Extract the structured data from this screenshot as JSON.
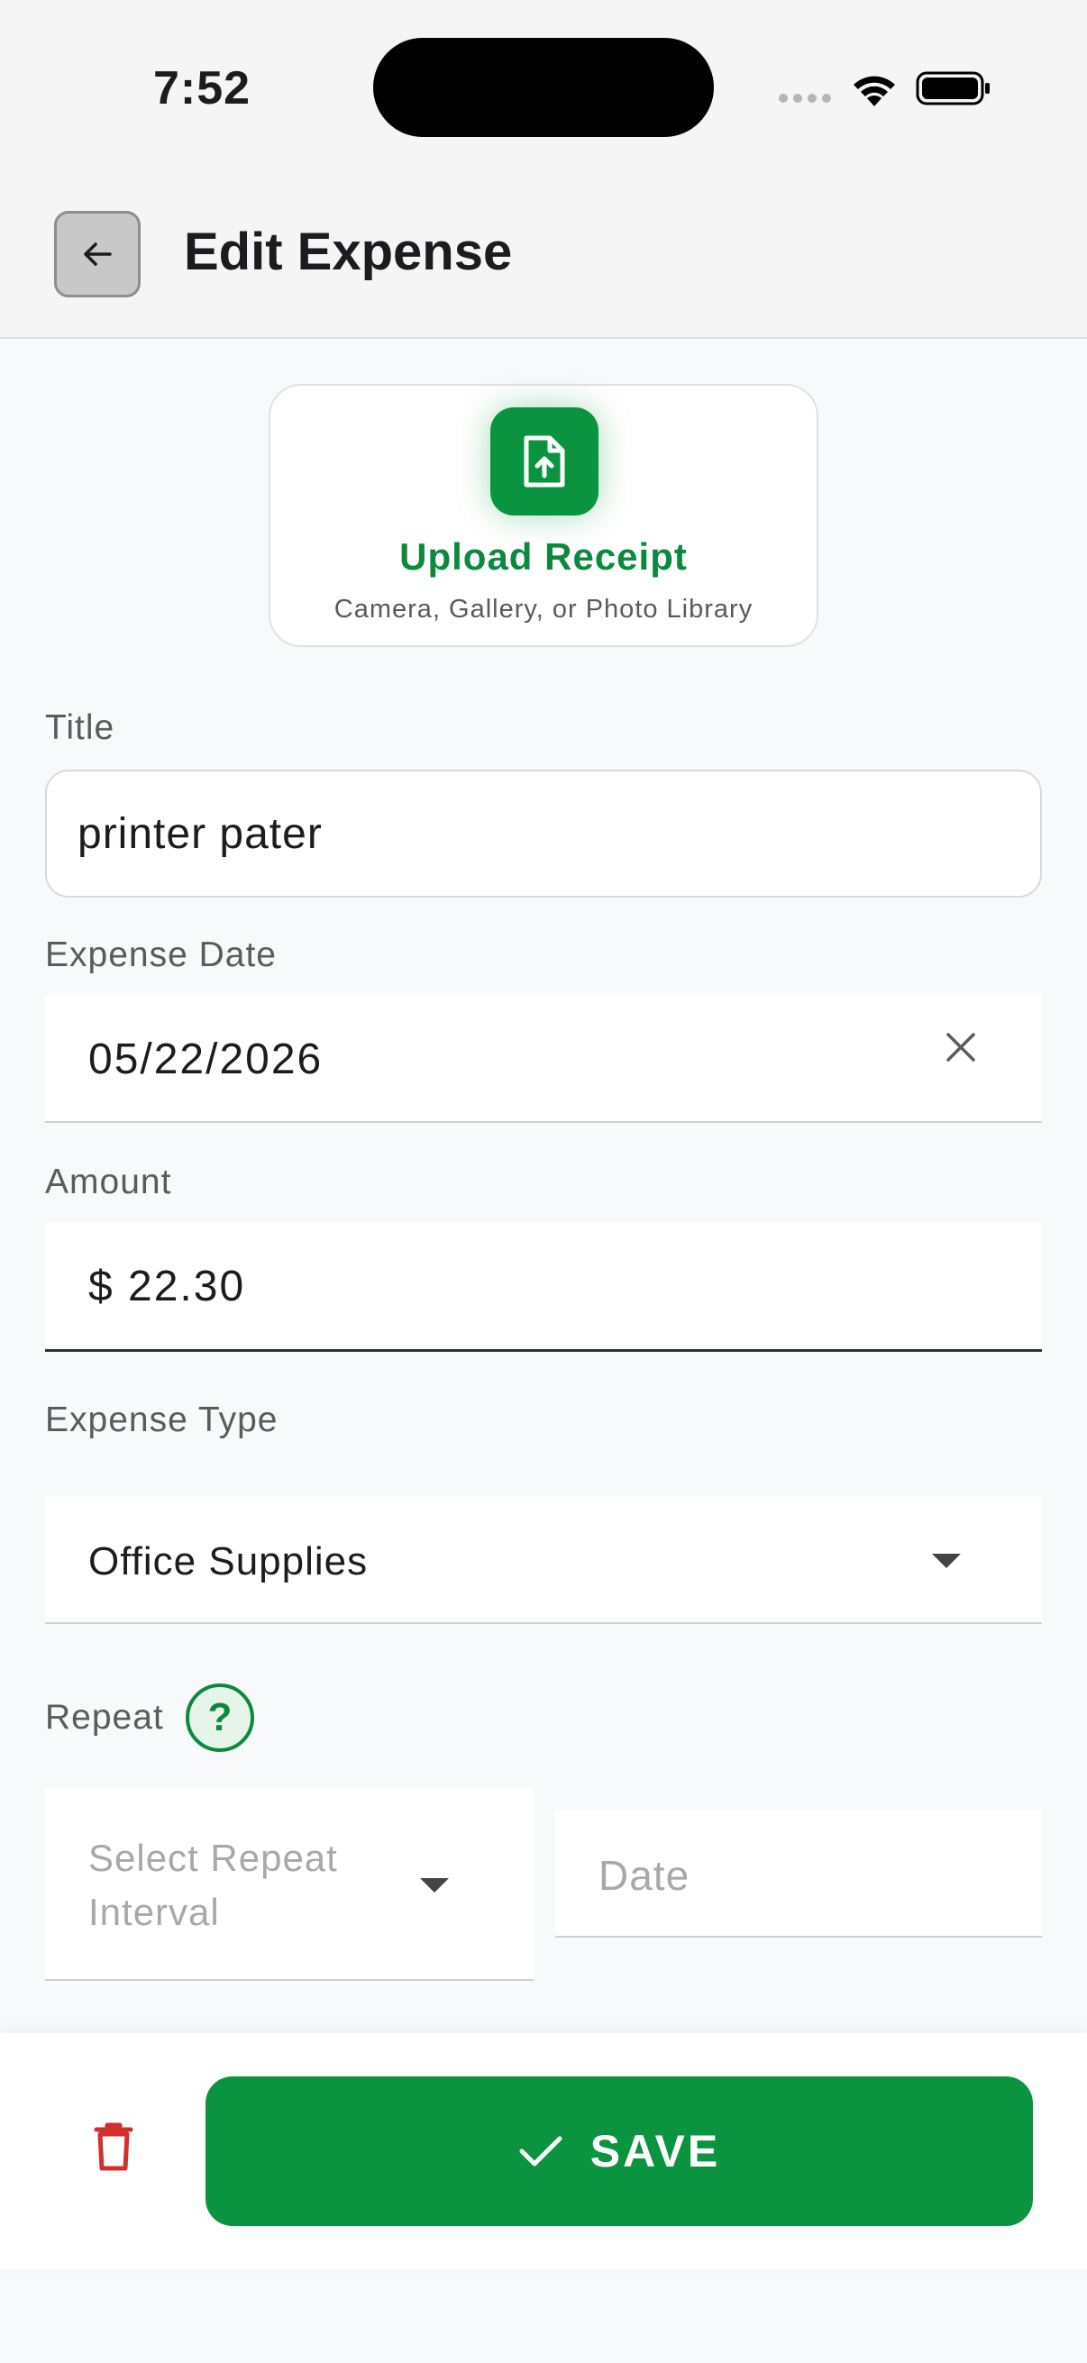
{
  "status": {
    "time": "7:52"
  },
  "header": {
    "title": "Edit Expense"
  },
  "upload": {
    "title": "Upload Receipt",
    "subtitle": "Camera, Gallery, or Photo Library"
  },
  "form": {
    "title_label": "Title",
    "title_value": "printer pater",
    "date_label": "Expense Date",
    "date_value": "05/22/2026",
    "amount_label": "Amount",
    "amount_value": "$ 22.30",
    "type_label": "Expense Type",
    "type_value": "Office Supplies",
    "repeat_label": "Repeat",
    "repeat_help": "?",
    "repeat_interval_placeholder": "Select Repeat Interval",
    "repeat_date_placeholder": "Date"
  },
  "actions": {
    "save_label": "SAVE"
  },
  "colors": {
    "accent": "#0a9440",
    "delete": "#d32f2f",
    "background": "#f8f9fb"
  },
  "icons": [
    "back-arrow-icon",
    "file-upload-icon",
    "close-icon",
    "caret-down-icon",
    "help-icon",
    "trash-icon",
    "checkmark-icon",
    "wifi-icon",
    "battery-icon"
  ]
}
